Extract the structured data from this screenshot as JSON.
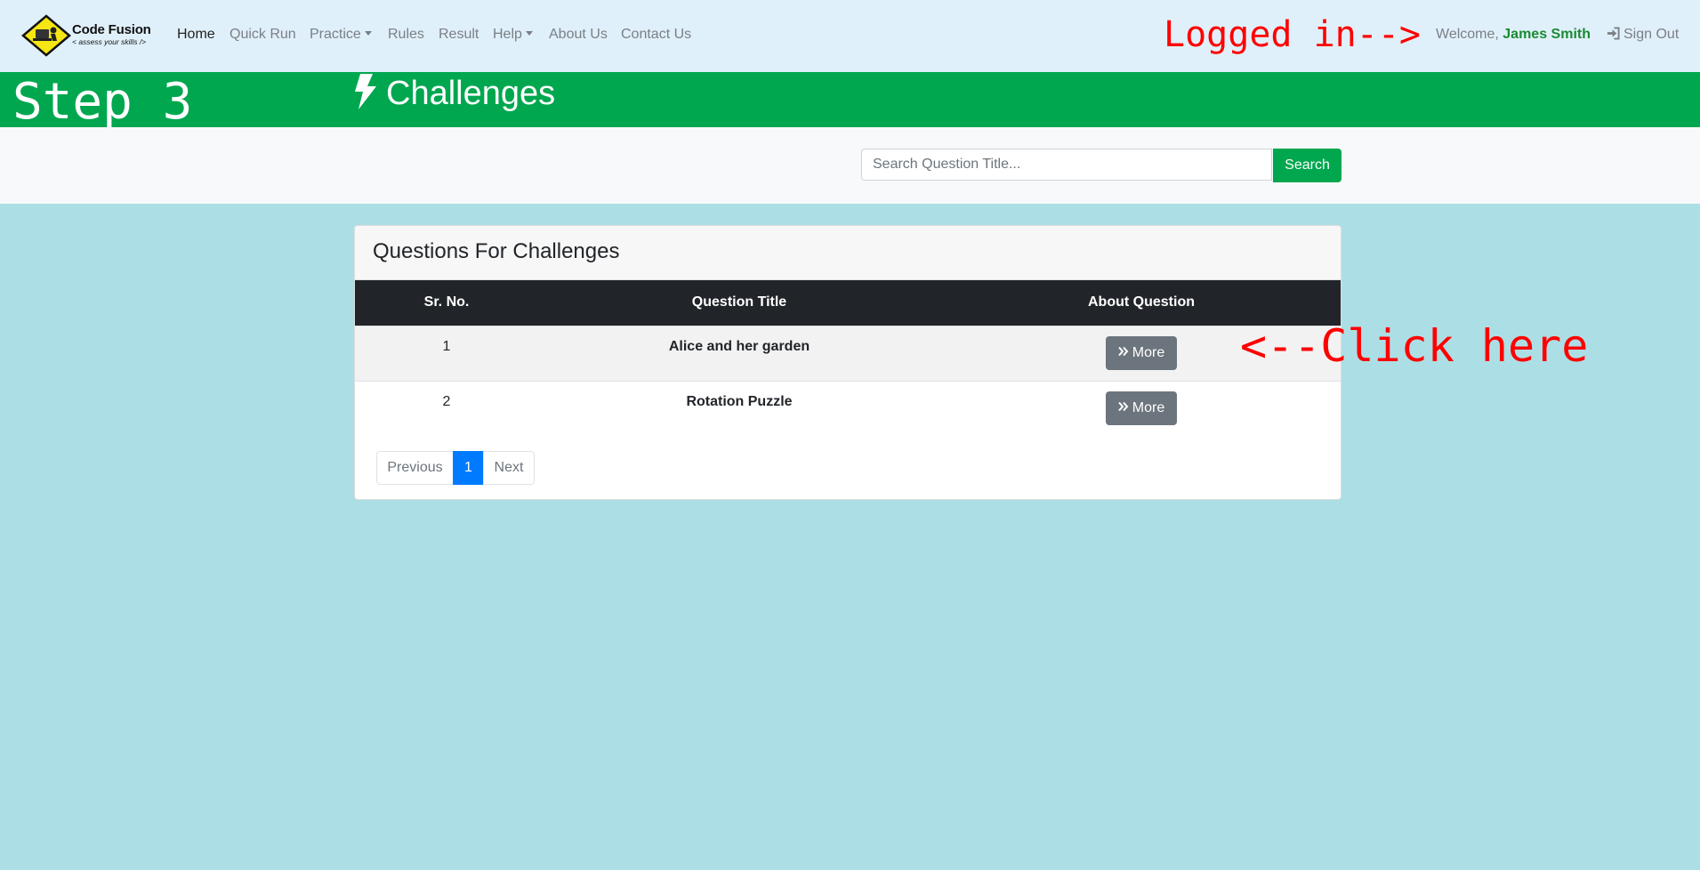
{
  "brand": {
    "name": "Code Fusion",
    "tagline": "< assess your skills />"
  },
  "nav": {
    "items": [
      {
        "label": "Home",
        "active": true
      },
      {
        "label": "Quick Run"
      },
      {
        "label": "Practice",
        "dropdown": true
      },
      {
        "label": "Rules"
      },
      {
        "label": "Result"
      },
      {
        "label": "Help",
        "dropdown": true
      },
      {
        "label": "About Us"
      },
      {
        "label": "Contact Us"
      }
    ]
  },
  "annotations": {
    "logged_in": "Logged in-->",
    "click_here": "<--Click here",
    "step": "Step 3"
  },
  "user": {
    "welcome_prefix": "Welcome, ",
    "name": "James Smith",
    "sign_out": "Sign Out"
  },
  "banner": {
    "title": "Challenges",
    "icon": "bolt-icon"
  },
  "search": {
    "placeholder": "Search Question Title...",
    "button": "Search"
  },
  "card": {
    "title": "Questions For Challenges",
    "columns": [
      "Sr. No.",
      "Question Title",
      "About Question"
    ],
    "rows": [
      {
        "sr": "1",
        "title": "Alice and her garden",
        "action": "More"
      },
      {
        "sr": "2",
        "title": "Rotation Puzzle",
        "action": "More"
      }
    ]
  },
  "pagination": {
    "previous": "Previous",
    "current": "1",
    "next": "Next"
  },
  "colors": {
    "nav_bg": "#e0f0fa",
    "banner_green": "#00a74f",
    "page_bg": "#acdfe5",
    "annotation_red": "#ff0000",
    "primary_blue": "#007bff",
    "secondary_gray": "#6c757d",
    "username_green": "#1a8a33"
  }
}
